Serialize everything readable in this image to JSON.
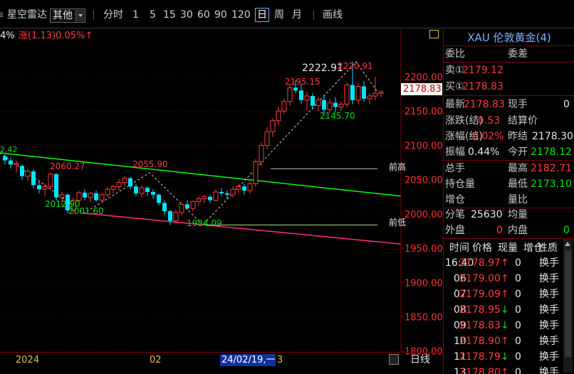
{
  "toolbar": {
    "app_name": "星空雷达",
    "period_selected": "其他",
    "periods": [
      "分时",
      "1",
      "5",
      "15",
      "30",
      "60",
      "90",
      "120",
      "日",
      "周",
      "月"
    ],
    "draw_line": "画线"
  },
  "chart_header": {
    "pct_left": "4%",
    "change_text": "涨(1.13)0.05%↑"
  },
  "chart_data": {
    "type": "candlestick",
    "y_ticks": [
      {
        "label": "2200.00",
        "value": 2200
      },
      {
        "label": "2150.00",
        "value": 2150
      },
      {
        "label": "2100.00",
        "value": 2100
      },
      {
        "label": "2050.00",
        "value": 2050
      },
      {
        "label": "2000.00",
        "value": 2000
      },
      {
        "label": "1950.00",
        "value": 1950
      },
      {
        "label": "1900.00",
        "value": 1900
      },
      {
        "label": "1850.00",
        "value": 1850
      },
      {
        "label": "1800.00",
        "value": 1800
      }
    ],
    "ylim": [
      1800,
      2250
    ],
    "x_labels": [
      "2024",
      "02",
      "3"
    ],
    "cursor_date": "24/02/19,一",
    "current_price": "2178.83",
    "annotations": [
      {
        "text": "2222.91",
        "color": "#e8e8e8"
      },
      {
        "text": "2220.91",
        "color": "#ff3b3b"
      },
      {
        "text": "2195.15",
        "color": "#ff3b3b"
      },
      {
        "text": "2145.70",
        "color": "#00e000"
      },
      {
        "text": "2060.27",
        "color": "#ff3b3b"
      },
      {
        "text": "2055.90",
        "color": "#ff3b3b"
      },
      {
        "text": "2012.90",
        "color": "#00e000"
      },
      {
        "text": "2001.60",
        "color": "#00e000"
      },
      {
        "text": "1984.09",
        "color": "#00e000"
      },
      {
        "text": "前高",
        "color": "#e8e8e8"
      },
      {
        "text": "前低",
        "color": "#e8e8e8"
      }
    ],
    "left_cut_label": "2,42",
    "candles": [
      {
        "o": 2084,
        "h": 2087,
        "l": 2072,
        "c": 2078
      },
      {
        "o": 2078,
        "h": 2082,
        "l": 2066,
        "c": 2072
      },
      {
        "o": 2072,
        "h": 2078,
        "l": 2060,
        "c": 2074
      },
      {
        "o": 2070,
        "h": 2072,
        "l": 2050,
        "c": 2055
      },
      {
        "o": 2055,
        "h": 2066,
        "l": 2048,
        "c": 2062
      },
      {
        "o": 2062,
        "h": 2065,
        "l": 2038,
        "c": 2042
      },
      {
        "o": 2042,
        "h": 2048,
        "l": 2030,
        "c": 2036
      },
      {
        "o": 2036,
        "h": 2044,
        "l": 2026,
        "c": 2040
      },
      {
        "o": 2040,
        "h": 2060,
        "l": 2035,
        "c": 2058
      },
      {
        "o": 2058,
        "h": 2060,
        "l": 2020,
        "c": 2024
      },
      {
        "o": 2024,
        "h": 2032,
        "l": 2012,
        "c": 2028
      },
      {
        "o": 2028,
        "h": 2030,
        "l": 2001,
        "c": 2005
      },
      {
        "o": 2005,
        "h": 2024,
        "l": 2001,
        "c": 2020
      },
      {
        "o": 2020,
        "h": 2034,
        "l": 2014,
        "c": 2031
      },
      {
        "o": 2031,
        "h": 2036,
        "l": 2020,
        "c": 2024
      },
      {
        "o": 2024,
        "h": 2032,
        "l": 2017,
        "c": 2030
      },
      {
        "o": 2030,
        "h": 2034,
        "l": 2018,
        "c": 2020
      },
      {
        "o": 2020,
        "h": 2030,
        "l": 2016,
        "c": 2028
      },
      {
        "o": 2028,
        "h": 2040,
        "l": 2024,
        "c": 2036
      },
      {
        "o": 2036,
        "h": 2042,
        "l": 2030,
        "c": 2040
      },
      {
        "o": 2040,
        "h": 2050,
        "l": 2034,
        "c": 2046
      },
      {
        "o": 2046,
        "h": 2056,
        "l": 2040,
        "c": 2052
      },
      {
        "o": 2052,
        "h": 2054,
        "l": 2036,
        "c": 2040
      },
      {
        "o": 2040,
        "h": 2044,
        "l": 2026,
        "c": 2030
      },
      {
        "o": 2030,
        "h": 2042,
        "l": 2024,
        "c": 2038
      },
      {
        "o": 2038,
        "h": 2040,
        "l": 2026,
        "c": 2032
      },
      {
        "o": 2032,
        "h": 2036,
        "l": 2022,
        "c": 2028
      },
      {
        "o": 2028,
        "h": 2030,
        "l": 2012,
        "c": 2016
      },
      {
        "o": 2016,
        "h": 2020,
        "l": 1998,
        "c": 2004
      },
      {
        "o": 2004,
        "h": 2006,
        "l": 1984,
        "c": 1990
      },
      {
        "o": 1990,
        "h": 2006,
        "l": 1986,
        "c": 2002
      },
      {
        "o": 2002,
        "h": 2016,
        "l": 1998,
        "c": 2014
      },
      {
        "o": 2014,
        "h": 2020,
        "l": 2006,
        "c": 2008
      },
      {
        "o": 2008,
        "h": 2020,
        "l": 2004,
        "c": 2018
      },
      {
        "o": 2018,
        "h": 2026,
        "l": 2012,
        "c": 2022
      },
      {
        "o": 2022,
        "h": 2028,
        "l": 2016,
        "c": 2025
      },
      {
        "o": 2025,
        "h": 2028,
        "l": 2016,
        "c": 2020
      },
      {
        "o": 2020,
        "h": 2036,
        "l": 2018,
        "c": 2032
      },
      {
        "o": 2032,
        "h": 2038,
        "l": 2026,
        "c": 2030
      },
      {
        "o": 2030,
        "h": 2034,
        "l": 2022,
        "c": 2028
      },
      {
        "o": 2028,
        "h": 2040,
        "l": 2024,
        "c": 2036
      },
      {
        "o": 2036,
        "h": 2044,
        "l": 2030,
        "c": 2040
      },
      {
        "o": 2040,
        "h": 2044,
        "l": 2028,
        "c": 2034
      },
      {
        "o": 2034,
        "h": 2048,
        "l": 2030,
        "c": 2044
      },
      {
        "o": 2044,
        "h": 2080,
        "l": 2040,
        "c": 2076
      },
      {
        "o": 2076,
        "h": 2104,
        "l": 2070,
        "c": 2100
      },
      {
        "o": 2100,
        "h": 2126,
        "l": 2094,
        "c": 2120
      },
      {
        "o": 2120,
        "h": 2140,
        "l": 2112,
        "c": 2136
      },
      {
        "o": 2136,
        "h": 2156,
        "l": 2130,
        "c": 2150
      },
      {
        "o": 2150,
        "h": 2168,
        "l": 2146,
        "c": 2164
      },
      {
        "o": 2164,
        "h": 2190,
        "l": 2158,
        "c": 2184
      },
      {
        "o": 2184,
        "h": 2195,
        "l": 2176,
        "c": 2180
      },
      {
        "o": 2180,
        "h": 2190,
        "l": 2160,
        "c": 2166
      },
      {
        "o": 2166,
        "h": 2178,
        "l": 2150,
        "c": 2172
      },
      {
        "o": 2172,
        "h": 2176,
        "l": 2152,
        "c": 2158
      },
      {
        "o": 2158,
        "h": 2170,
        "l": 2150,
        "c": 2166
      },
      {
        "o": 2166,
        "h": 2174,
        "l": 2145,
        "c": 2152
      },
      {
        "o": 2152,
        "h": 2168,
        "l": 2146,
        "c": 2162
      },
      {
        "o": 2162,
        "h": 2170,
        "l": 2148,
        "c": 2156
      },
      {
        "o": 2156,
        "h": 2164,
        "l": 2150,
        "c": 2160
      },
      {
        "o": 2160,
        "h": 2192,
        "l": 2156,
        "c": 2188
      },
      {
        "o": 2188,
        "h": 2222,
        "l": 2160,
        "c": 2166
      },
      {
        "o": 2166,
        "h": 2190,
        "l": 2160,
        "c": 2186
      },
      {
        "o": 2186,
        "h": 2194,
        "l": 2164,
        "c": 2168
      },
      {
        "o": 2168,
        "h": 2176,
        "l": 2160,
        "c": 2172
      },
      {
        "o": 2172,
        "h": 2200,
        "l": 2166,
        "c": 2176
      },
      {
        "o": 2176,
        "h": 2180,
        "l": 2170,
        "c": 2178
      }
    ]
  },
  "panel": {
    "title": "XAU 伦敦黄金(4)",
    "weibi_label": "委比",
    "weicha_label": "委差",
    "sell_label": "卖①",
    "sell_value": "2179.12",
    "buy_label": "买①",
    "buy_value": "2178.83",
    "latest_label": "最新",
    "latest_value": "2178.83",
    "xianshou_label": "现手",
    "xianshou_value": "0",
    "zhangdie_label": "涨跌(结)",
    "zhangdie_value": "0.53",
    "jiesuan_label": "结算价",
    "zhangfu_label": "涨幅(结)",
    "zhangfu_value": "0.02%",
    "zuojie_label": "昨结",
    "zuojie_value": "2178.30",
    "zhenfu_label": "振幅",
    "zhenfu_value": "0.44%",
    "jinkai_label": "今开",
    "jinkai_value": "2178.12",
    "zongshou_label": "总手",
    "zuigao_label": "最高",
    "zuigao_value": "2182.71",
    "chicang_label": "持仓量",
    "zuidi_label": "最低",
    "zuidi_value": "2173.10",
    "zengcang_label": "增仓",
    "liangbi_label": "量比",
    "fenbi_label": "分笔",
    "fenbi_value": "25630",
    "junliang_label": "均量",
    "waipan_label": "外盘",
    "waipan_value": "0",
    "neipan_label": "内盘",
    "neipan_value": "0"
  },
  "trades": {
    "headers": [
      "时间",
      "价格",
      "现量",
      "增仓",
      "性质"
    ],
    "rows": [
      {
        "time": "16:40",
        "price": "2178.97",
        "arrow": "↑",
        "vol": "0",
        "nature": "换手"
      },
      {
        "time": "06",
        "price": "2179.00",
        "arrow": "↑",
        "vol": "0",
        "nature": "换手"
      },
      {
        "time": "07",
        "price": "2179.09",
        "arrow": "↑",
        "vol": "0",
        "nature": "换手"
      },
      {
        "time": "08",
        "price": "2178.95",
        "arrow": "↓",
        "vol": "0",
        "nature": "换手"
      },
      {
        "time": "09",
        "price": "2178.83",
        "arrow": "↓",
        "vol": "0",
        "nature": "换手"
      },
      {
        "time": "10",
        "price": "2178.90",
        "arrow": "↑",
        "vol": "0",
        "nature": "换手"
      },
      {
        "time": "11",
        "price": "2178.79",
        "arrow": "↓",
        "vol": "0",
        "nature": "换手"
      },
      {
        "time": "13",
        "price": "2178.80",
        "arrow": "↑",
        "vol": "0",
        "nature": "换手"
      }
    ]
  },
  "bottom": {
    "period_label": "日线"
  },
  "colors": {
    "up": "#ff3b3b",
    "down": "#00e5ff",
    "green_line": "#00ff00",
    "pink_line": "#ff2d8a",
    "panel_border": "#7a0000"
  }
}
